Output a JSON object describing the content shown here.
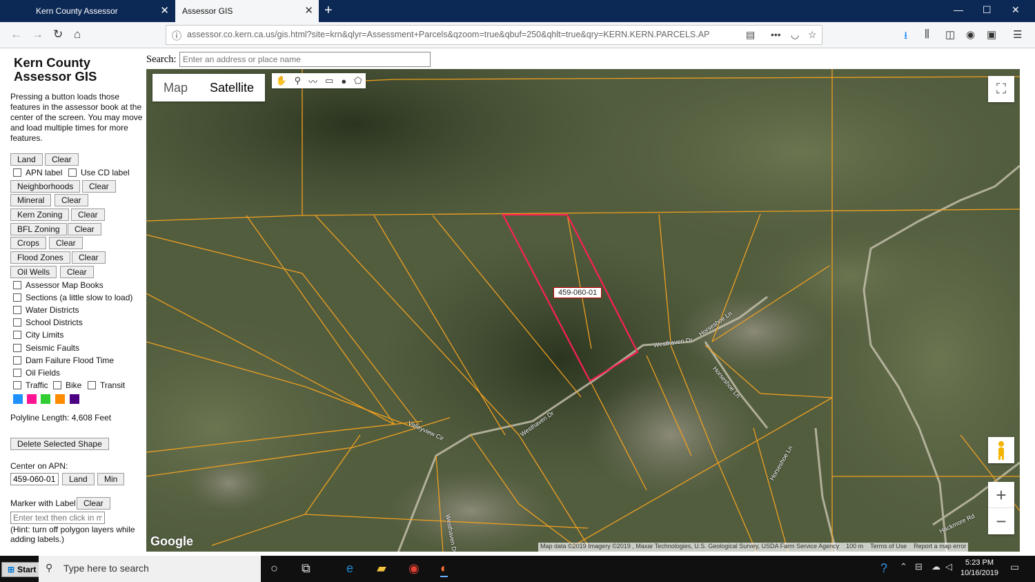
{
  "browser": {
    "tabs": [
      {
        "label": "Kern County Assessor",
        "active": false
      },
      {
        "label": "Assessor GIS",
        "active": true
      }
    ],
    "url": "assessor.co.kern.ca.us/gis.html?site=krn&qlyr=Assessment+Parcels&qzoom=true&qbuf=250&qhlt=true&qry=KERN.KERN.PARCELS.AP"
  },
  "sidebar": {
    "title": "Kern County Assessor GIS",
    "description": "Pressing a button loads those features in the assessor book at the center of the screen. You may move and load multiple times for more features.",
    "layer_buttons": [
      {
        "label": "Land",
        "clear": "Clear"
      },
      {
        "label": "Neighborhoods",
        "clear": "Clear"
      },
      {
        "label": "Mineral",
        "clear": "Clear"
      },
      {
        "label": "Kern Zoning",
        "clear": "Clear"
      },
      {
        "label": "BFL Zoning",
        "clear": "Clear"
      },
      {
        "label": "Crops",
        "clear": "Clear"
      },
      {
        "label": "Flood Zones",
        "clear": "Clear"
      },
      {
        "label": "Oil Wells",
        "clear": "Clear"
      }
    ],
    "apn_label": "APN label",
    "cd_label": "Use CD label",
    "checkboxes": [
      "Assessor Map Books",
      "Sections (a little slow to load)",
      "Water Districts",
      "School Districts",
      "City Limits",
      "Seismic Faults",
      "Dam Failure Flood Time",
      "Oil Fields"
    ],
    "traffic": "Traffic",
    "bike": "Bike",
    "transit": "Transit",
    "swatch_colors": [
      "#1e90ff",
      "#ff1493",
      "#32cd32",
      "#ff8c00",
      "#4b0082"
    ],
    "polyline_length": "Polyline Length: 4,608 Feet",
    "delete_shape": "Delete Selected Shape",
    "center_label": "Center on APN:",
    "apn_value": "459-060-01",
    "land_btn": "Land",
    "min_btn": "Min",
    "marker_label": "Marker with Label",
    "marker_clear": "Clear",
    "marker_placeholder": "Enter text then click in m",
    "hint": "(Hint: turn off polygon layers while adding labels.)"
  },
  "search": {
    "label": "Search:",
    "placeholder": "Enter an address or place name"
  },
  "map": {
    "map_btn": "Map",
    "satellite_btn": "Satellite",
    "selected_apn": "459-060-01",
    "roads": [
      "Westhaven Dr",
      "Horseshoe Ln",
      "Horseshoe Ln",
      "Horseshoe Ln",
      "Westhaven Dr",
      "Valleyview Cir",
      "Westhaven Dr",
      "Hackmore Rd"
    ],
    "google": "Google",
    "attribution": "Map data ©2019 Imagery ©2019 , Maxar Technologies, U.S. Geological Survey, USDA Farm Service Agency",
    "scale": "100 m",
    "terms": "Terms of Use",
    "report": "Report a map error",
    "colors": {
      "parcel": "#f0a020",
      "highlight": "#ff2050"
    }
  },
  "taskbar": {
    "start": "Start",
    "search_placeholder": "Type here to search",
    "time": "5:23 PM",
    "date": "10/16/2019"
  }
}
